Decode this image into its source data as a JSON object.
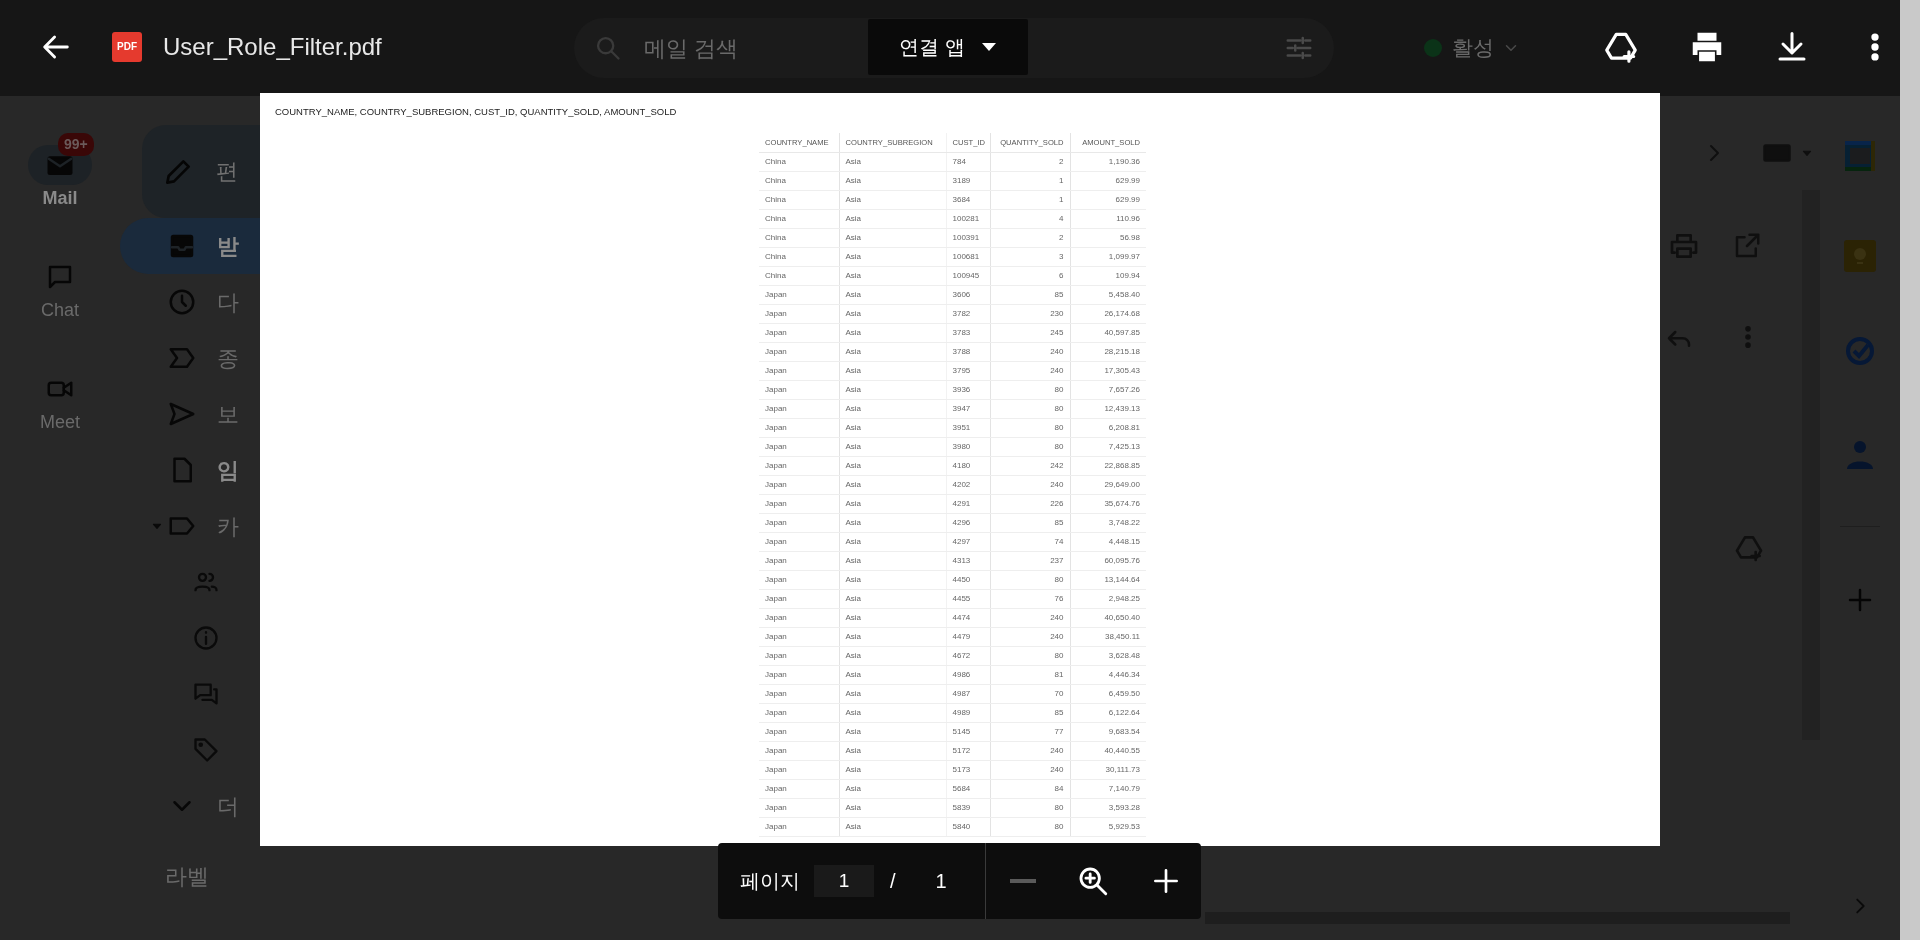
{
  "background": {
    "search_placeholder": "메일 검색",
    "status": "활성",
    "rail": [
      {
        "label": "Mail",
        "selected": true,
        "badge": "99+"
      },
      {
        "label": "Chat",
        "selected": false
      },
      {
        "label": "Meet",
        "selected": false
      }
    ],
    "compose": "편",
    "folders": [
      {
        "label": "받",
        "selected": true,
        "bold": true
      },
      {
        "label": "다",
        "selected": false,
        "bold": false
      },
      {
        "label": "종",
        "selected": false,
        "bold": false
      },
      {
        "label": "보",
        "selected": false,
        "bold": false
      },
      {
        "label": "임",
        "selected": false,
        "bold": true
      },
      {
        "label": "카",
        "selected": false,
        "bold": false,
        "expanded": true
      },
      {
        "label": "더",
        "selected": false,
        "bold": false
      }
    ],
    "labels_heading": "라벨"
  },
  "viewer": {
    "pdf_icon_label": "PDF",
    "file_name": "User_Role_Filter.pdf",
    "open_with_button": "연결 앱"
  },
  "document": {
    "heading": "COUNTRY_NAME, COUNTRY_SUBREGION, CUST_ID, QUANTITY_SOLD, AMOUNT_SOLD",
    "table": {
      "columns": [
        "COUNTRY_NAME",
        "COUNTRY_SUBREGION",
        "CUST_ID",
        "QUANTITY_SOLD",
        "AMOUNT_SOLD"
      ],
      "rows": [
        [
          "China",
          "Asia",
          "784",
          "2",
          "1,190.36"
        ],
        [
          "China",
          "Asia",
          "3189",
          "1",
          "629.99"
        ],
        [
          "China",
          "Asia",
          "3684",
          "1",
          "629.99"
        ],
        [
          "China",
          "Asia",
          "100281",
          "4",
          "110.96"
        ],
        [
          "China",
          "Asia",
          "100391",
          "2",
          "56.98"
        ],
        [
          "China",
          "Asia",
          "100681",
          "3",
          "1,099.97"
        ],
        [
          "China",
          "Asia",
          "100945",
          "6",
          "109.94"
        ],
        [
          "Japan",
          "Asia",
          "3606",
          "85",
          "5,458.40"
        ],
        [
          "Japan",
          "Asia",
          "3782",
          "230",
          "26,174.68"
        ],
        [
          "Japan",
          "Asia",
          "3783",
          "245",
          "40,597.85"
        ],
        [
          "Japan",
          "Asia",
          "3788",
          "240",
          "28,215.18"
        ],
        [
          "Japan",
          "Asia",
          "3795",
          "240",
          "17,305.43"
        ],
        [
          "Japan",
          "Asia",
          "3936",
          "80",
          "7,657.26"
        ],
        [
          "Japan",
          "Asia",
          "3947",
          "80",
          "12,439.13"
        ],
        [
          "Japan",
          "Asia",
          "3951",
          "80",
          "6,208.81"
        ],
        [
          "Japan",
          "Asia",
          "3980",
          "80",
          "7,425.13"
        ],
        [
          "Japan",
          "Asia",
          "4180",
          "242",
          "22,868.85"
        ],
        [
          "Japan",
          "Asia",
          "4202",
          "240",
          "29,649.00"
        ],
        [
          "Japan",
          "Asia",
          "4291",
          "226",
          "35,674.76"
        ],
        [
          "Japan",
          "Asia",
          "4296",
          "85",
          "3,748.22"
        ],
        [
          "Japan",
          "Asia",
          "4297",
          "74",
          "4,448.15"
        ],
        [
          "Japan",
          "Asia",
          "4313",
          "237",
          "60,095.76"
        ],
        [
          "Japan",
          "Asia",
          "4450",
          "80",
          "13,144.64"
        ],
        [
          "Japan",
          "Asia",
          "4455",
          "76",
          "2,948.25"
        ],
        [
          "Japan",
          "Asia",
          "4474",
          "240",
          "40,650.40"
        ],
        [
          "Japan",
          "Asia",
          "4479",
          "240",
          "38,450.11"
        ],
        [
          "Japan",
          "Asia",
          "4672",
          "80",
          "3,628.48"
        ],
        [
          "Japan",
          "Asia",
          "4986",
          "81",
          "4,446.34"
        ],
        [
          "Japan",
          "Asia",
          "4987",
          "70",
          "6,459.50"
        ],
        [
          "Japan",
          "Asia",
          "4989",
          "85",
          "6,122.64"
        ],
        [
          "Japan",
          "Asia",
          "5145",
          "77",
          "9,683.54"
        ],
        [
          "Japan",
          "Asia",
          "5172",
          "240",
          "40,440.55"
        ],
        [
          "Japan",
          "Asia",
          "5173",
          "240",
          "30,111.73"
        ],
        [
          "Japan",
          "Asia",
          "5684",
          "84",
          "7,140.79"
        ],
        [
          "Japan",
          "Asia",
          "5839",
          "80",
          "3,593.28"
        ],
        [
          "Japan",
          "Asia",
          "5840",
          "80",
          "5,929.53"
        ]
      ]
    }
  },
  "page_controls": {
    "label": "페이지",
    "current_page": "1",
    "separator": "/",
    "total_pages": "1",
    "zoom_out": {
      "disabled": true
    }
  }
}
